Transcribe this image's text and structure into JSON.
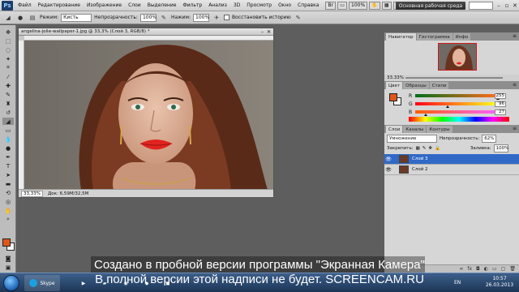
{
  "menubar": {
    "logo": "Ps",
    "items": [
      "Файл",
      "Редактирование",
      "Изображение",
      "Слои",
      "Выделение",
      "Фильтр",
      "Анализ",
      "3D",
      "Просмотр",
      "Окно",
      "Справка"
    ],
    "zoom": "100%",
    "workspace": "Основная рабочая среда"
  },
  "options": {
    "mode_label": "Режим:",
    "mode_value": "Кисть",
    "opacity_label": "Непрозрачность:",
    "opacity_value": "100%",
    "pressure_label": "Нажим:",
    "pressure_value": "100%",
    "history_label": "Восстановить историю"
  },
  "document": {
    "title": "angelina-jolie-wallpaper-1.jpg @ 33,3% (Слой 3, RGB/8) *",
    "zoom": "33,33%",
    "doc_info": "Док: 6,59M/32,5M"
  },
  "navigator": {
    "tabs": [
      "Навигатор",
      "Гистограмма",
      "Инфо"
    ],
    "zoom": "33.33%"
  },
  "color": {
    "tabs": [
      "Цвет",
      "Образцы",
      "Стили"
    ],
    "channels": [
      {
        "label": "R",
        "value": "255",
        "bar": "linear-gradient(90deg,#006d1b,#ff6d1b)",
        "fill": 1.0
      },
      {
        "label": "G",
        "value": "96",
        "bar": "linear-gradient(90deg,#ff001b,#ffff1b)",
        "fill": 0.376
      },
      {
        "label": "B",
        "value": "27",
        "bar": "linear-gradient(90deg,#ff6000,#ff60ff)",
        "fill": 0.106
      }
    ],
    "foreground": "#e0561a"
  },
  "layers": {
    "tabs": [
      "Слои",
      "Каналы",
      "Контуры"
    ],
    "blend_mode": "Умножение",
    "opacity_label": "Непрозрачность:",
    "opacity_value": "62%",
    "lock_label": "Закрепить:",
    "fill_label": "Заливка:",
    "fill_value": "100%",
    "items": [
      {
        "name": "Слой 3",
        "selected": true
      },
      {
        "name": "Слой 2",
        "selected": false
      }
    ],
    "bottom_icons": [
      "link-icon",
      "fx-icon",
      "mask-icon",
      "adjustment-icon",
      "folder-icon",
      "new-layer-icon",
      "trash-icon"
    ]
  },
  "watermark": {
    "line1": "Создано в пробной версии программы \"Экранная Камера\"",
    "line2": "В полной версии этой надписи не будет. SCREENCAM.RU"
  },
  "taskbar": {
    "apps": [
      "Skype",
      "Photoshop"
    ],
    "lang": "EN",
    "time": "10:57",
    "date": "26.03.2013"
  }
}
